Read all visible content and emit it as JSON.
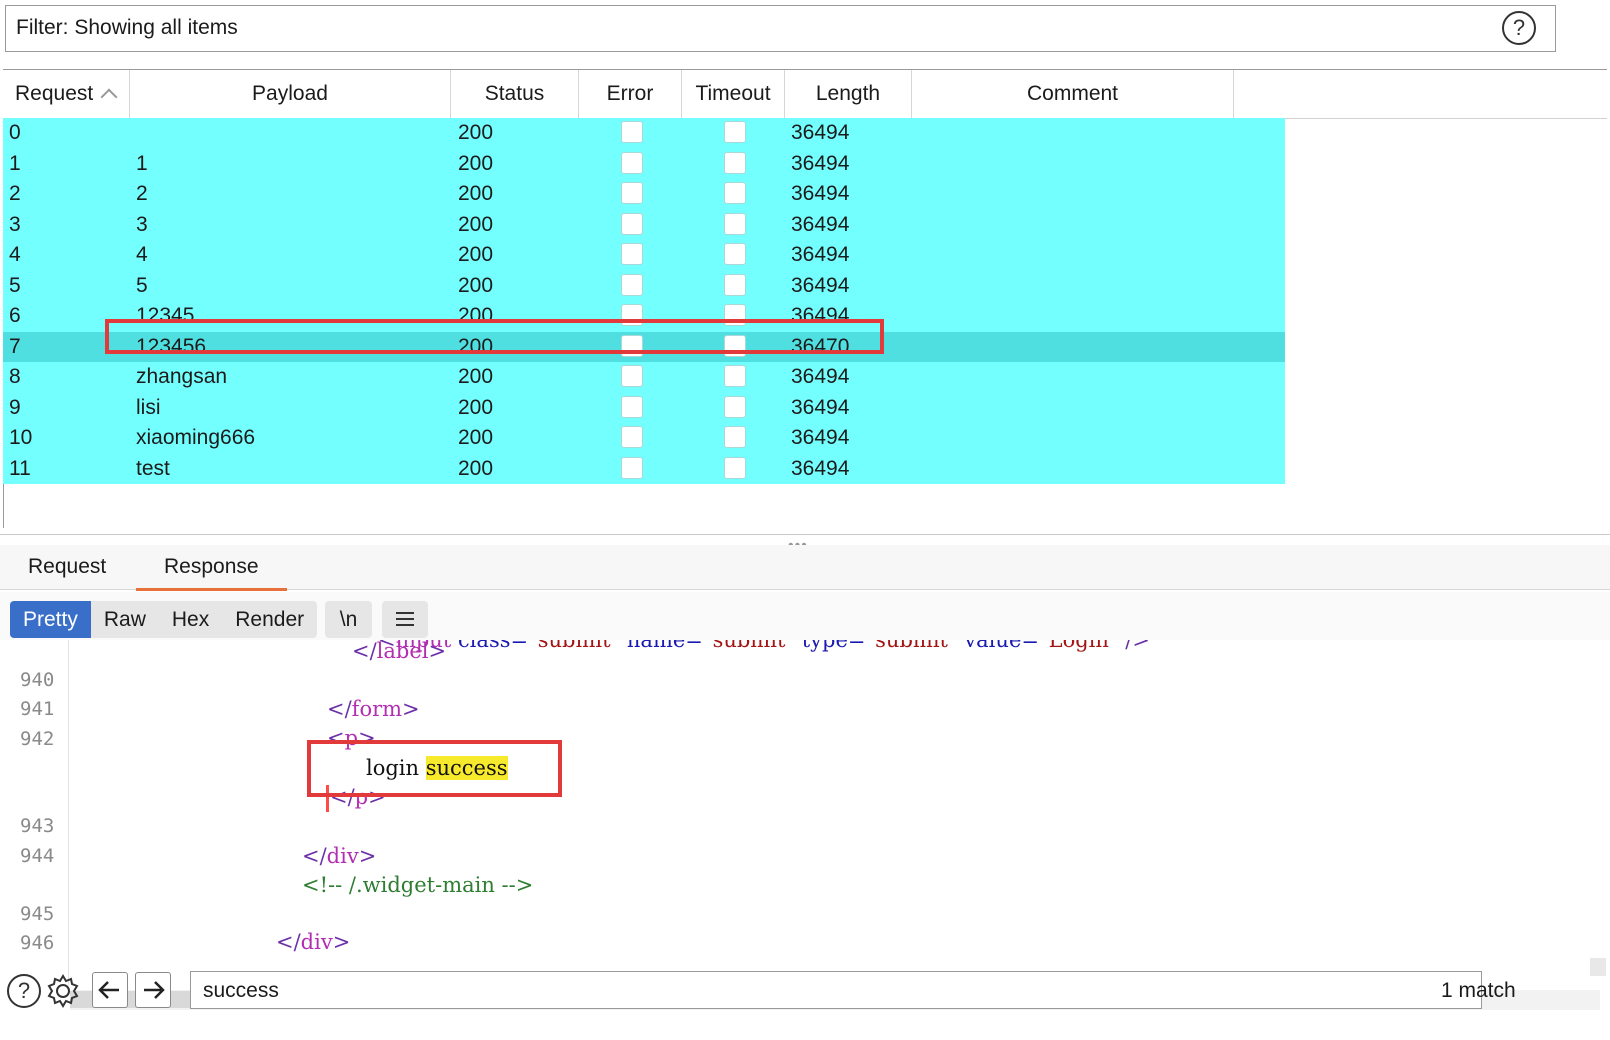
{
  "filter": {
    "text": "Filter: Showing all items",
    "help_glyph": "?"
  },
  "table": {
    "columns": [
      "Request",
      "Payload",
      "Status",
      "Error",
      "Timeout",
      "Length",
      "Comment"
    ],
    "rows": [
      {
        "request": "0",
        "payload": "",
        "status": "200",
        "length": "36494"
      },
      {
        "request": "1",
        "payload": "1",
        "status": "200",
        "length": "36494"
      },
      {
        "request": "2",
        "payload": "2",
        "status": "200",
        "length": "36494"
      },
      {
        "request": "3",
        "payload": "3",
        "status": "200",
        "length": "36494"
      },
      {
        "request": "4",
        "payload": "4",
        "status": "200",
        "length": "36494"
      },
      {
        "request": "5",
        "payload": "5",
        "status": "200",
        "length": "36494"
      },
      {
        "request": "6",
        "payload": "12345",
        "status": "200",
        "length": "36494"
      },
      {
        "request": "7",
        "payload": "123456",
        "status": "200",
        "length": "36470",
        "selected": true
      },
      {
        "request": "8",
        "payload": "zhangsan",
        "status": "200",
        "length": "36494"
      },
      {
        "request": "9",
        "payload": "lisi",
        "status": "200",
        "length": "36494"
      },
      {
        "request": "10",
        "payload": "xiaoming666",
        "status": "200",
        "length": "36494"
      },
      {
        "request": "11",
        "payload": "test",
        "status": "200",
        "length": "36494"
      }
    ]
  },
  "detail_tabs": {
    "request": "Request",
    "response": "Response",
    "active": "Response"
  },
  "view_modes": {
    "pretty": "Pretty",
    "raw": "Raw",
    "hex": "Hex",
    "render": "Render",
    "newline": "\\n",
    "menu_icon": "hamburger-icon"
  },
  "code": {
    "line_numbers": [
      "940",
      "941",
      "942",
      "943",
      "944",
      "945",
      "946"
    ],
    "lines": {
      "input_line": {
        "lt": "<",
        "tag": "input",
        "attr1": " class=",
        "val1": "\"submit\"",
        "attr2": " name=",
        "val2": "\"submit\"",
        "attr3": " type=",
        "val3": "\"submit\"",
        "attr4": " value=",
        "val4": "\"Login\"",
        "end": " />"
      },
      "label_close": {
        "lt": "</",
        "tag": "label",
        "gt": ">"
      },
      "form_close": {
        "lt": "</",
        "tag": "form",
        "gt": ">"
      },
      "p_open": {
        "lt": "<",
        "tag": "p",
        "gt": ">"
      },
      "login_text": "login ",
      "success_text": "success",
      "p_close": {
        "lt": "</",
        "tag": "p",
        "gt": ">"
      },
      "div_close": {
        "lt": "</",
        "tag": "div",
        "gt": ">"
      },
      "comment": "<!-- /.widget-main -->",
      "div_close2": {
        "lt": "</",
        "tag": "div",
        "gt": ">"
      }
    }
  },
  "search": {
    "value": "success",
    "match_count": "1 match",
    "icons": [
      "help-icon",
      "gear-icon",
      "arrow-left-icon",
      "arrow-right-icon"
    ]
  },
  "colors": {
    "row_highlight": "#74ffff",
    "row_selected": "#4fdfe0",
    "active_tab_underline": "#e8703a",
    "active_view_button": "#3a6fc9",
    "annotation_red": "#e23a3a",
    "search_highlight": "#f7ea2c"
  }
}
